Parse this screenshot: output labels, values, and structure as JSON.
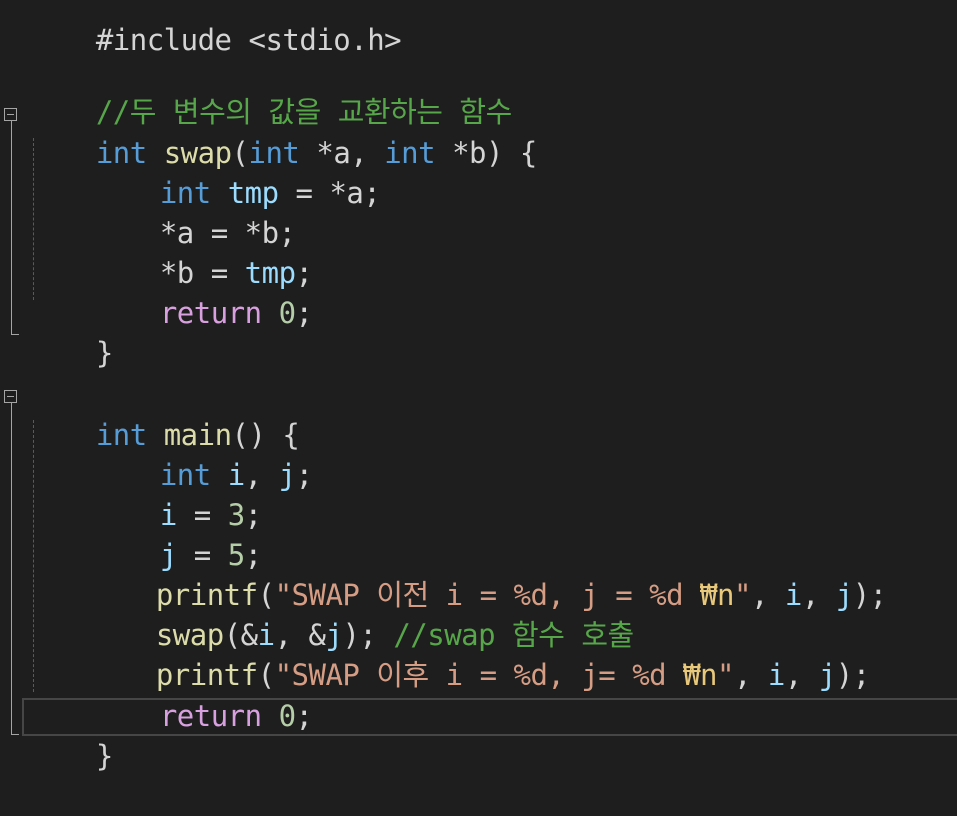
{
  "editor": {
    "lines": {
      "include_partial": "#include <stdio.h>",
      "comment_swap": "//두 변수의 값을 교환하는 함수",
      "swap_kw_int": "int",
      "swap_name": "swap",
      "swap_open": "(",
      "swap_p1_type": "int",
      "swap_p1": " *a, ",
      "swap_p2_type": "int",
      "swap_p2": " *b) {",
      "l_tmp_kw": "int",
      "l_tmp_var": "tmp",
      "l_tmp_rest": " = *a;",
      "l_a": "*a = *b;",
      "l_b_pre": "*b = ",
      "l_b_var": "tmp",
      "l_b_end": ";",
      "ret1_kw": "return",
      "ret1_val": "0",
      "ret1_end": ";",
      "close1": "}",
      "main_kw": "int",
      "main_name": "main",
      "main_rest": "() {",
      "decl_kw": "int",
      "decl_i": "i",
      "decl_sep": ", ",
      "decl_j": "j",
      "decl_end": ";",
      "assign_i_var": "i",
      "assign_i_op": " = ",
      "assign_i_num": "3",
      "assign_i_end": ";",
      "assign_j_var": "j",
      "assign_j_op": " = ",
      "assign_j_num": "5",
      "assign_j_end": ";",
      "p1_fn": "printf",
      "p1_open": "(",
      "p1_str": "\"SWAP 이전 i = %d, j = %d ",
      "p1_esc": "₩n",
      "p1_q": "\"",
      "p1_sep1": ", ",
      "p1_i": "i",
      "p1_sep2": ", ",
      "p1_j": "j",
      "p1_end": ");",
      "call_fn": "swap",
      "call_open": "(&",
      "call_i": "i",
      "call_mid": ", &",
      "call_j": "j",
      "call_end": "); ",
      "call_cmt": "//swap 함수 호출",
      "p2_fn": "printf",
      "p2_open": "(",
      "p2_str": "\"SWAP 이후 i = %d, j= %d ",
      "p2_esc": "₩n",
      "p2_q": "\"",
      "p2_sep1": ", ",
      "p2_i": "i",
      "p2_sep2": ", ",
      "p2_j": "j",
      "p2_end": ");",
      "ret2_kw": "return",
      "ret2_val": "0",
      "ret2_end": ";",
      "close2": "}"
    }
  }
}
